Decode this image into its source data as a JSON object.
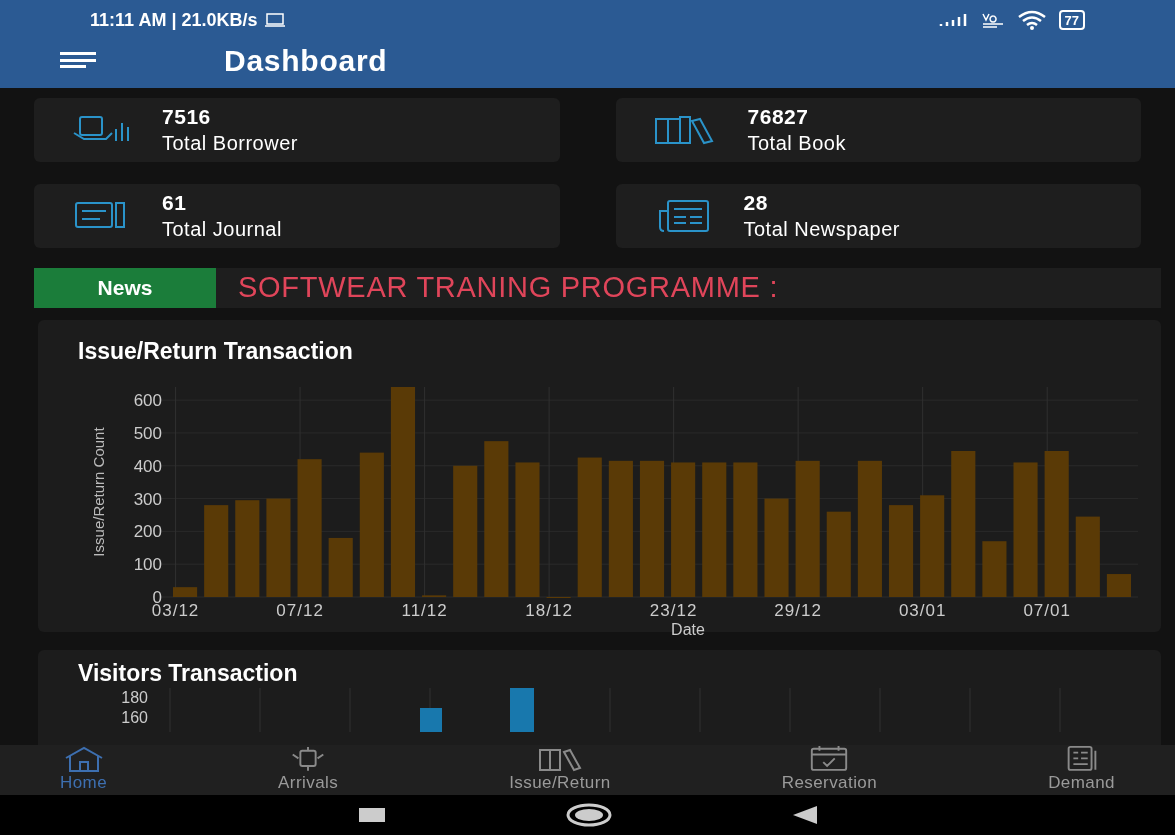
{
  "status_bar": {
    "time": "11:11 AM | 21.0KB/s",
    "battery": "77"
  },
  "header": {
    "title": "Dashboard"
  },
  "stats": [
    {
      "value": "7516",
      "label": "Total Borrower",
      "kind": "borrower"
    },
    {
      "value": "76827",
      "label": "Total Book",
      "kind": "book"
    },
    {
      "value": "61",
      "label": "Total Journal",
      "kind": "journal"
    },
    {
      "value": "28",
      "label": "Total Newspaper",
      "kind": "newspaper"
    }
  ],
  "news": {
    "label": "News",
    "text": "SOFTWEAR TRANING PROGRAMME :"
  },
  "issue_chart": {
    "title": "Issue/Return Transaction",
    "chart_data": {
      "type": "bar",
      "xlabel": "Date",
      "ylabel": "Issue/Return Count",
      "categories": [
        "03/12",
        null,
        null,
        null,
        "07/12",
        null,
        null,
        null,
        "11/12",
        null,
        null,
        null,
        "18/12",
        null,
        null,
        null,
        "23/12",
        null,
        null,
        null,
        "29/12",
        null,
        null,
        null,
        "03/01",
        null,
        null,
        null,
        "07/01",
        null,
        null
      ],
      "series": [
        {
          "color": "#5a3a06",
          "values": [
            30,
            280,
            295,
            300,
            420,
            180,
            440,
            640,
            5,
            400,
            475,
            410,
            0,
            425,
            415,
            415,
            410,
            410,
            410,
            300,
            415,
            260,
            415,
            280,
            310,
            445,
            170,
            410,
            445,
            245,
            70
          ]
        }
      ],
      "ylim": [
        0,
        640
      ],
      "grid": true,
      "yticks": [
        0,
        100,
        200,
        300,
        400,
        500,
        600
      ]
    }
  },
  "visitors_chart": {
    "title": "Visitors Transaction",
    "ytick_labels": [
      "180",
      "160"
    ]
  },
  "bottom_nav": [
    {
      "label": "Home",
      "kind": "home",
      "selected": true
    },
    {
      "label": "Arrivals",
      "kind": "arrivals",
      "selected": false
    },
    {
      "label": "Issue/Return",
      "kind": "issue",
      "selected": false
    },
    {
      "label": "Reservation",
      "kind": "reservation",
      "selected": false
    },
    {
      "label": "Demand",
      "kind": "demand",
      "selected": false
    }
  ]
}
